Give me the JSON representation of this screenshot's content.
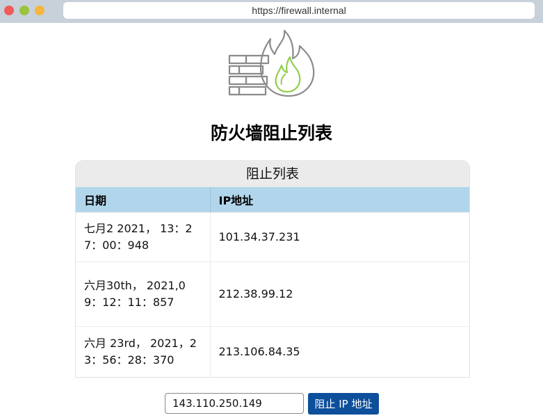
{
  "browser": {
    "url": "https://firewall.internal"
  },
  "page": {
    "title": "防火墙阻止列表",
    "logo_icon": "firewall-icon"
  },
  "blocklist": {
    "caption": "阻止列表",
    "columns": [
      "日期",
      "IP地址"
    ],
    "rows": [
      {
        "date": "七月2 2021， 13：27：00：948",
        "ip": "101.34.37.231"
      },
      {
        "date": "六月30th， 2021,09：12：11：857",
        "ip": "212.38.99.12"
      },
      {
        "date": "六月 23rd， 2021，23：56：28：370",
        "ip": "213.106.84.35"
      }
    ]
  },
  "form": {
    "ip_value": "143.110.250.149",
    "button_label": "阻止 IP 地址"
  },
  "colors": {
    "header_bg": "#b1d6ec",
    "button_bg": "#0d4f9b",
    "flame_green": "#8fce4a"
  }
}
